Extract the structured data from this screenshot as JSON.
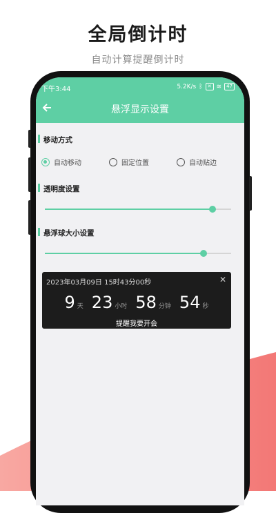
{
  "promo": {
    "title": "全局倒计时",
    "subtitle": "自动计算提醒倒计时"
  },
  "status_bar": {
    "time": "下午3:44",
    "speed": "5.2K/s",
    "battery": "47"
  },
  "nav": {
    "title": "悬浮显示设置"
  },
  "move_mode": {
    "label": "移动方式",
    "options": [
      "自动移动",
      "固定位置",
      "自动贴边"
    ],
    "selected": 0
  },
  "opacity": {
    "label": "透明度设置",
    "value_fraction": 0.9
  },
  "ball_size": {
    "label": "悬浮球大小设置",
    "value_fraction": 0.85
  },
  "countdown": {
    "datetime": "2023年03月09日 15时43分00秒",
    "days": "9",
    "days_unit": "天",
    "hours": "23",
    "hours_unit": "小时",
    "minutes": "58",
    "minutes_unit": "分钟",
    "seconds": "54",
    "seconds_unit": "秒",
    "message": "提醒我要开会"
  },
  "colors": {
    "accent": "#5ecfa4",
    "pink": "#f47a78"
  }
}
